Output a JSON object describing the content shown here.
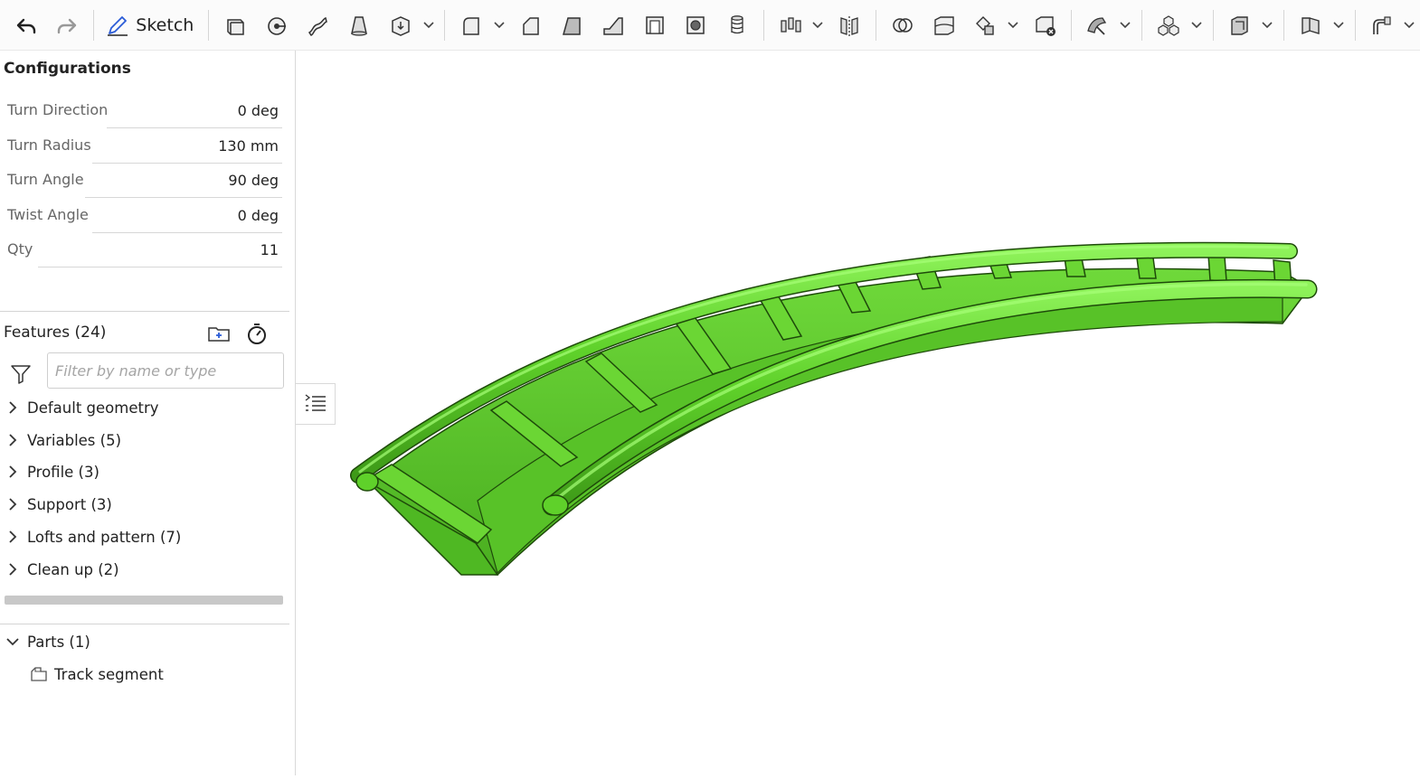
{
  "toolbar": {
    "undo_icon": "undo-icon",
    "redo_icon": "redo-icon",
    "sketch_label": "Sketch",
    "tools": [
      "extrude",
      "revolve",
      "sweep",
      "loft",
      "thicken",
      "fillet",
      "chamfer",
      "draft",
      "rib",
      "shell",
      "hole",
      "thread",
      "mirror-pattern",
      "linear-pattern",
      "boolean",
      "split",
      "transform",
      "delete-part",
      "modify",
      "assembly",
      "frame",
      "sheet-metal",
      "route"
    ]
  },
  "configurations": {
    "title": "Configurations",
    "rows": [
      {
        "label": "Turn Direction",
        "value": "0 deg"
      },
      {
        "label": "Turn Radius",
        "value": "130 mm"
      },
      {
        "label": "Turn Angle",
        "value": "90 deg"
      },
      {
        "label": "Twist Angle",
        "value": "0 deg"
      },
      {
        "label": "Qty",
        "value": "11"
      }
    ]
  },
  "features": {
    "title": "Features (24)",
    "filter_placeholder": "Filter by name or type",
    "items": [
      {
        "label": "Default geometry"
      },
      {
        "label": "Variables (5)"
      },
      {
        "label": "Profile (3)"
      },
      {
        "label": "Support (3)"
      },
      {
        "label": "Lofts and pattern (7)"
      },
      {
        "label": "Clean up (2)"
      }
    ]
  },
  "parts": {
    "title": "Parts (1)",
    "items": [
      {
        "label": "Track segment"
      }
    ]
  },
  "colors": {
    "track_green": "#5fd12a",
    "track_green_dark": "#3f9a1a"
  }
}
